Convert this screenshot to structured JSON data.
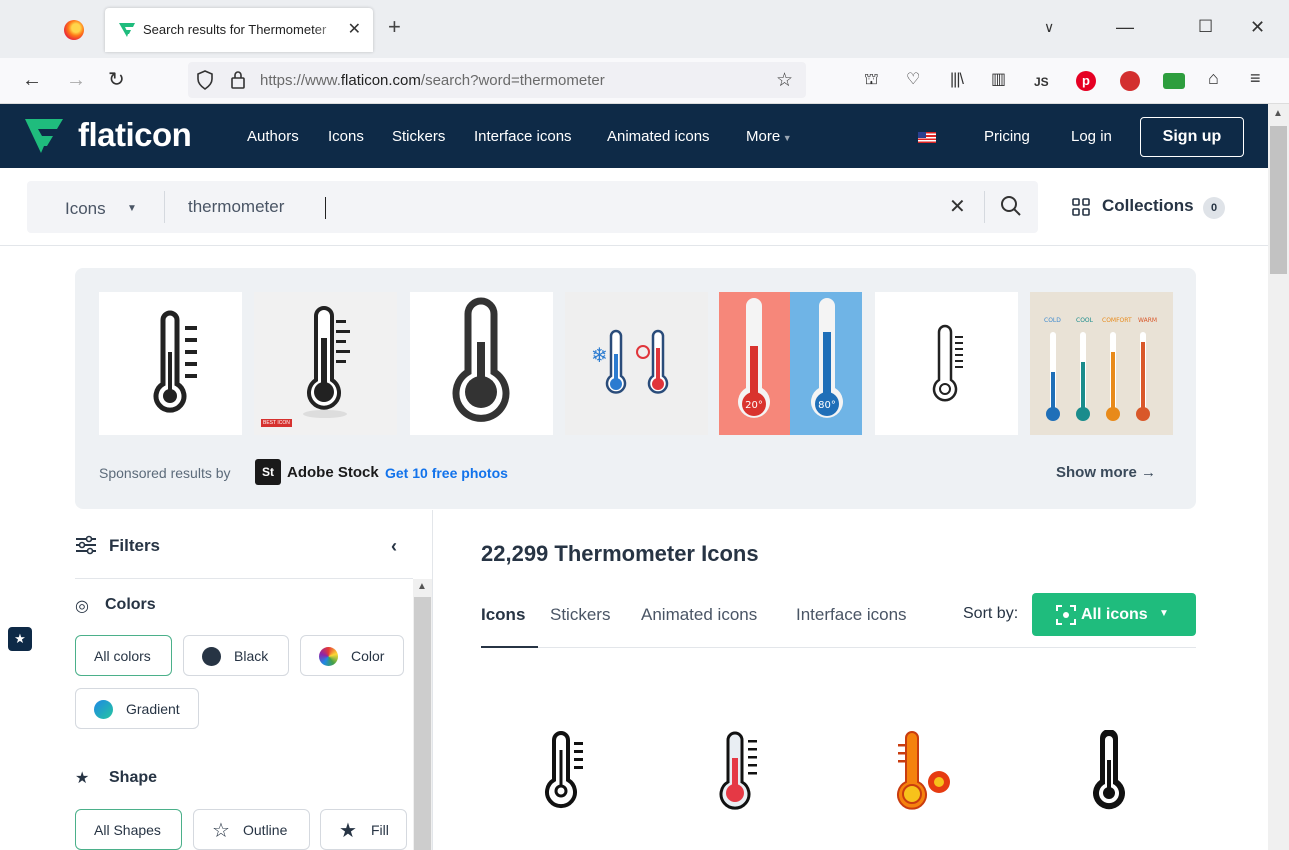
{
  "browser": {
    "tab_title": "Search results for Thermometer",
    "tab_close": "✕",
    "new_tab": "+",
    "url_prefix": "https://www.",
    "url_domain": "flaticon.com",
    "url_path": "/search?word=thermometer",
    "ext_js": "JS"
  },
  "header": {
    "logo": "flaticon",
    "nav": [
      "Authors",
      "Icons",
      "Stickers",
      "Interface icons",
      "Animated icons",
      "More"
    ],
    "pricing": "Pricing",
    "login": "Log in",
    "signup": "Sign up"
  },
  "search": {
    "type": "Icons",
    "query": "thermometer",
    "collections_label": "Collections",
    "collections_count": "0"
  },
  "sponsored": {
    "label": "Sponsored results by",
    "provider_logo": "St",
    "provider": "Adobe Stock",
    "promo_link": "Get 10 free photos",
    "show_more": "Show more →",
    "badge_text": "BEST ICON",
    "temp_left": "20°",
    "temp_right": "80°",
    "scale_labels": [
      "COLD",
      "COOL",
      "COMFORT",
      "WARM"
    ]
  },
  "filters": {
    "title": "Filters",
    "colors_title": "Colors",
    "color_options": [
      "All colors",
      "Black",
      "Color",
      "Gradient"
    ],
    "shape_title": "Shape",
    "shape_options": [
      "All Shapes",
      "Outline",
      "Fill"
    ]
  },
  "results": {
    "title": "22,299 Thermometer Icons",
    "tabs": [
      "Icons",
      "Stickers",
      "Animated icons",
      "Interface icons"
    ],
    "sort_label": "Sort by:",
    "sort_value": "All icons"
  },
  "colors": {
    "header_bg": "#0e2a47",
    "accent_green": "#1fbc7d",
    "link_blue": "#1273eb"
  }
}
